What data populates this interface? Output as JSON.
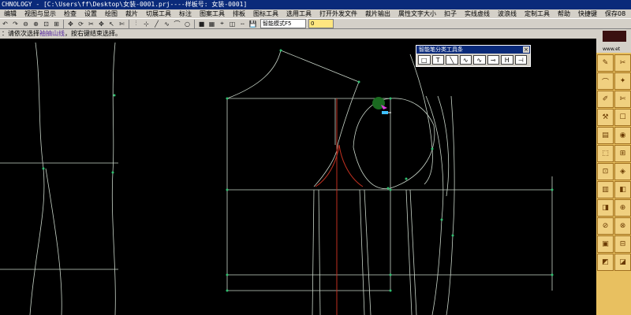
{
  "window": {
    "title": "CHNOLOGY - [C:\\Users\\ff\\Desktop\\女装-0001.prj----样板号: 女装-0001]"
  },
  "menu": [
    "编辑",
    "视图与显示",
    "检查",
    "设置",
    "绘图",
    "裁片",
    "切展工具",
    "标注",
    "图案工具",
    "排板",
    "图标工具",
    "选用工具",
    "打开外发文件",
    "裁片输出",
    "属性文字大小",
    "扣子",
    "实线虚线",
    "波浪线",
    "定制工具",
    "帮助",
    "快捷键",
    "保存08"
  ],
  "toolbar": {
    "icons": [
      "undo-icon",
      "redo-icon",
      "zoom-out-icon",
      "zoom-in-icon",
      "zoom-fit-icon",
      "zoom-window-icon",
      "pan-icon",
      "refresh-icon",
      "cut-icon",
      "move-icon",
      "select-icon",
      "scissors-icon",
      "align-icon",
      "measure-icon",
      "line-icon",
      "curve-icon",
      "arc-icon",
      "circle-icon",
      "color-icon",
      "grid-icon",
      "snap-icon",
      "layer-icon",
      "dash-icon",
      "save-icon"
    ],
    "glyphs": [
      "↶",
      "↷",
      "⊖",
      "⊕",
      "⊡",
      "⊞",
      "✥",
      "⟳",
      "✂",
      "✥",
      "↖",
      "✄",
      "⫶",
      "⊹",
      "╱",
      "∿",
      "⌒",
      "○",
      "■",
      "▦",
      "⌖",
      "◫",
      "╌",
      "💾"
    ],
    "mode_select": "智能模式F5",
    "number_value": "0"
  },
  "prompt": {
    "prefix": "：请依次选择",
    "highlight": "袖抽山线",
    "suffix": "，按右键结束选择。"
  },
  "palette": {
    "title": "智能笔分类工具条",
    "close": "×",
    "tools": [
      "□",
      "T",
      "╲",
      "∿",
      "∿",
      "⊸",
      "H",
      "⊣"
    ]
  },
  "right_panel": {
    "logo_text": "www.et",
    "buttons": [
      "✎",
      "✂",
      "⌒",
      "✦",
      "✐",
      "✄",
      "⚒",
      "☐",
      "▤",
      "◉",
      "⬚",
      "⊞",
      "⊡",
      "◈",
      "▥",
      "◧",
      "◨",
      "⊕",
      "⊘",
      "⊗",
      "▣",
      "⊟",
      "◩",
      "◪"
    ]
  },
  "colors": {
    "canvas": "#000000",
    "pattern_line": "#c8d4c8",
    "sleeve_curve": "#c03020",
    "node": "#30c070",
    "title_bar": "#0a2a7a",
    "panel_bg": "#d4d0c8"
  }
}
